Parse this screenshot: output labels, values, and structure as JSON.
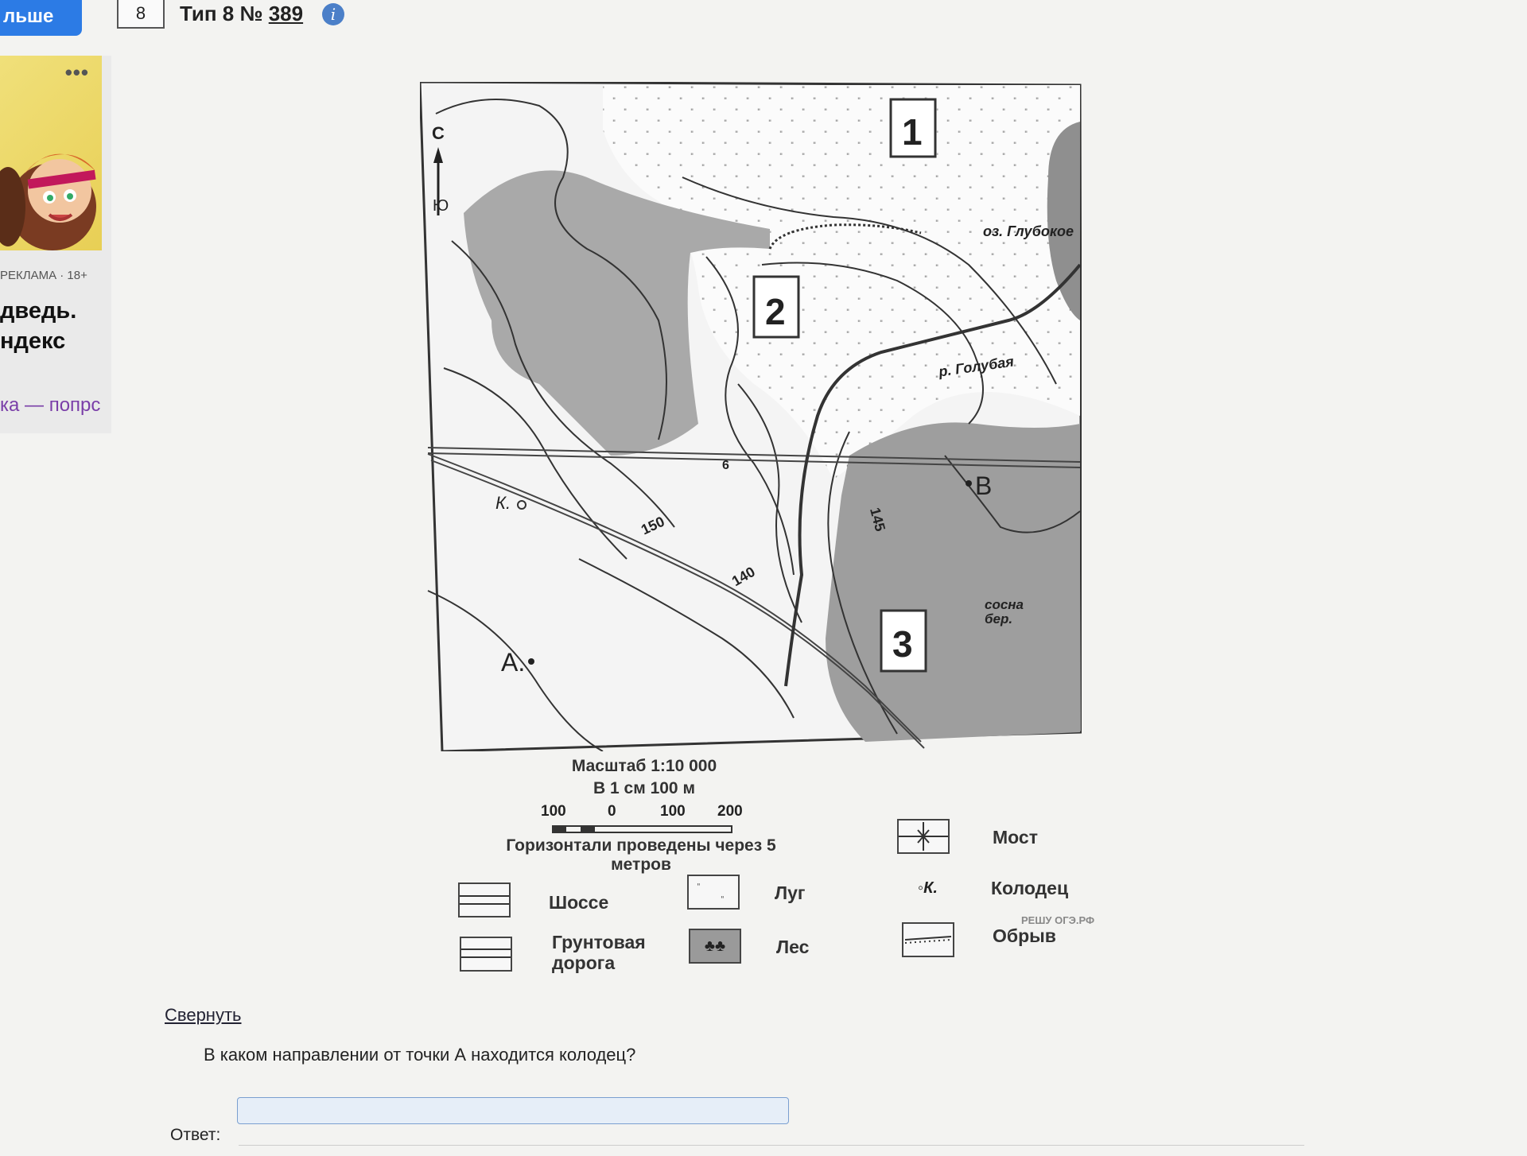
{
  "nav": {
    "prev_button": "льше",
    "task_number": "8"
  },
  "task": {
    "type_prefix": "Тип 8 №",
    "id_link": "389",
    "info_icon": "info-icon"
  },
  "ad": {
    "label": "РЕКЛАМА · 18+",
    "title_line1": "дведь.",
    "title_line2": "ндекс",
    "link": "ка — попрс",
    "more_icon": "three-dots-icon"
  },
  "map": {
    "square_labels": [
      "1",
      "2",
      "3"
    ],
    "compass_north": "С",
    "compass_south": "Ю",
    "lake_label": "оз. Глубокое",
    "river_label": "р. Голубая",
    "point_a": "А.",
    "point_b": "В",
    "well_label": "К.",
    "forest_type_line1": "сосна",
    "forest_type_line2": "бер.",
    "contour_labels": [
      "150",
      "140",
      "145"
    ],
    "road_marker": "6"
  },
  "scale": {
    "title": "Масштаб 1:10 000",
    "subtitle": "В 1 см 100 м",
    "ticks": [
      "100",
      "0",
      "100",
      "200"
    ],
    "contours_note": "Горизонтали проведены через 5 метров"
  },
  "legend": {
    "highway": "Шоссе",
    "dirt_road_line1": "Грунтовая",
    "dirt_road_line2": "дорога",
    "meadow": "Луг",
    "forest": "Лес",
    "bridge": "Мост",
    "well": "Колодец",
    "well_symbol": "К.",
    "cliff": "Обрыв",
    "watermark": "РЕШУ ОГЭ.РФ"
  },
  "collapse_link": "Свернуть",
  "question": "В каком направлении от точки А находится колодец?",
  "answer": {
    "label": "Ответ:",
    "value": ""
  }
}
